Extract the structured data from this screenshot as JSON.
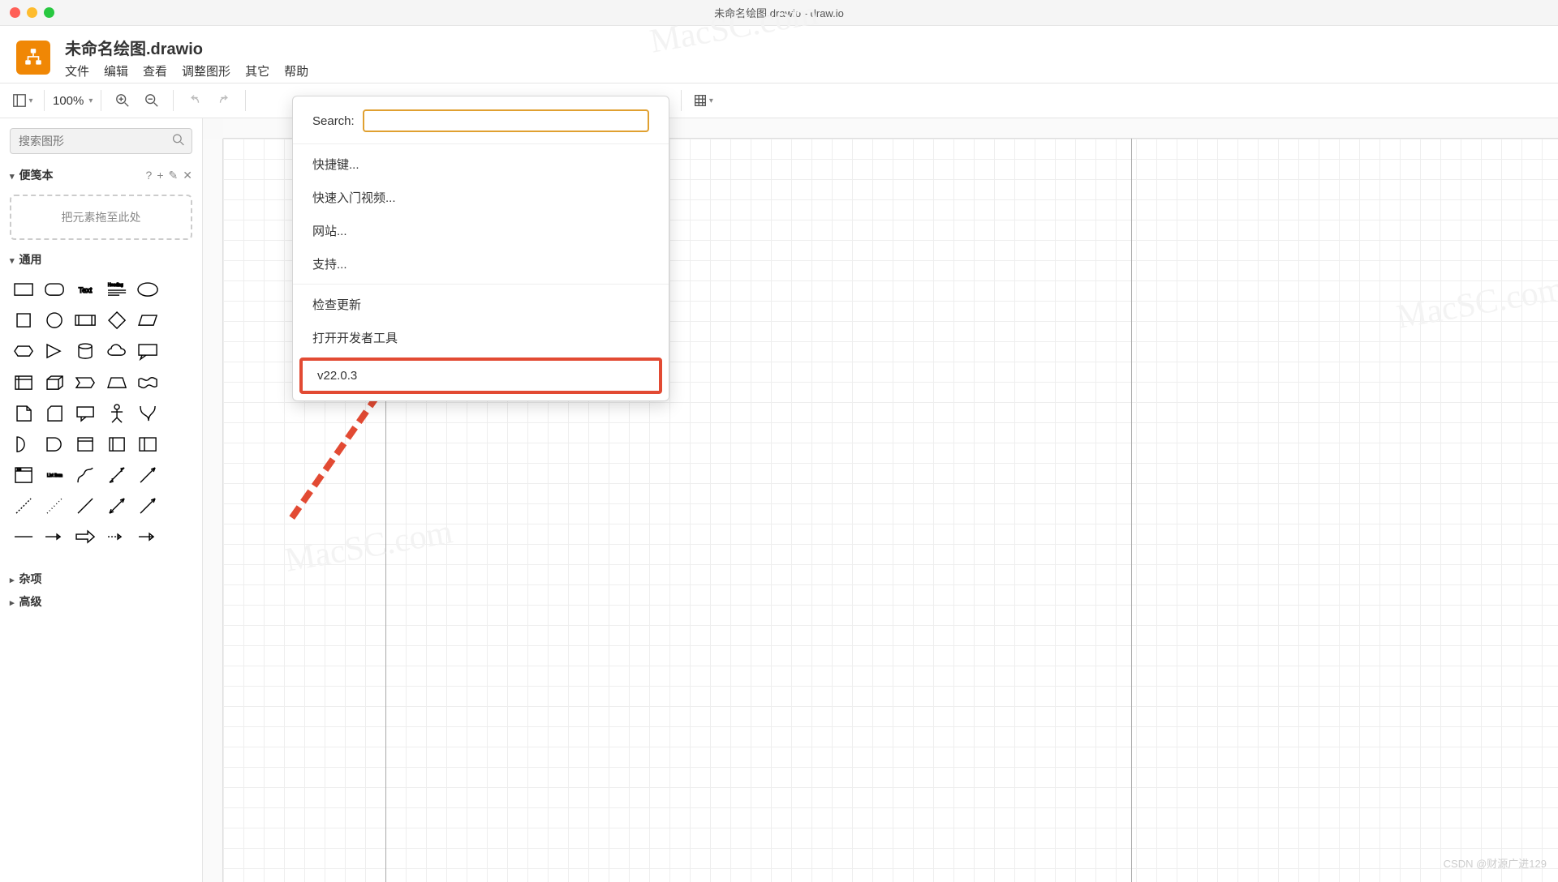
{
  "window": {
    "title": "未命名绘图.drawio - draw.io"
  },
  "doc_title": "未命名绘图.drawio",
  "menubar": {
    "file": "文件",
    "edit": "编辑",
    "view": "查看",
    "adjust": "调整图形",
    "other": "其它",
    "help": "帮助"
  },
  "toolbar": {
    "zoom": "100%"
  },
  "sidebar": {
    "search_placeholder": "搜索图形",
    "scratchpad": {
      "title": "便笺本",
      "help": "?",
      "add": "+",
      "edit": "✎",
      "close": "✕",
      "dropzone": "把元素拖至此处"
    },
    "general": {
      "title": "通用"
    },
    "misc": {
      "title": "杂项"
    },
    "advanced": {
      "title": "高级"
    }
  },
  "help_menu": {
    "search_label": "Search:",
    "items": {
      "shortcuts": "快捷键...",
      "quickstart": "快速入门视频...",
      "website": "网站...",
      "support": "支持...",
      "check_update": "检查更新",
      "devtools": "打开开发者工具",
      "version": "v22.0.3"
    }
  },
  "watermark": "MacSC.com",
  "credit": "CSDN @财源广进129"
}
